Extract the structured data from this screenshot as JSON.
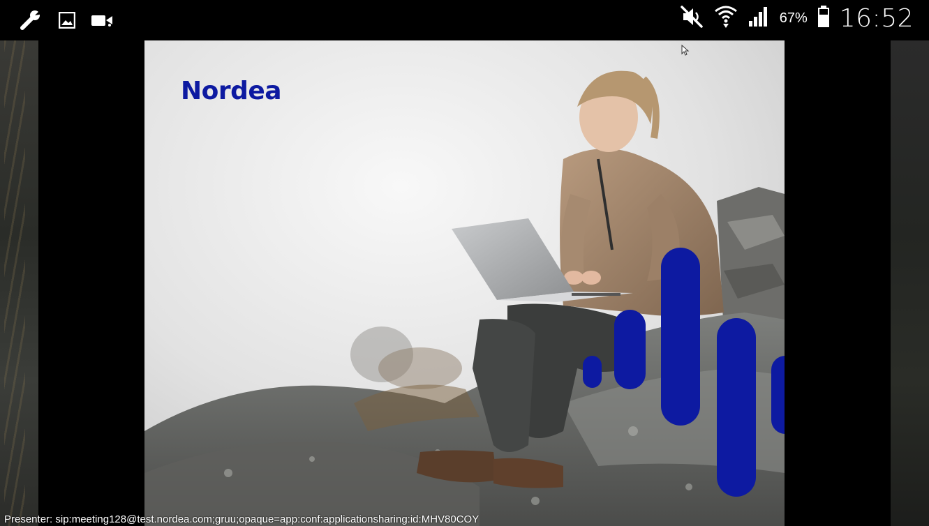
{
  "status_bar": {
    "left_icons": [
      "wrench-icon",
      "image-icon",
      "video-icon"
    ],
    "right_icons": [
      "mute-icon",
      "wifi-icon",
      "signal-icon",
      "battery-icon"
    ],
    "battery_percent": "67%",
    "time": "16:52"
  },
  "slide": {
    "brand": "Nordea",
    "brand_color": "#0d1aa1",
    "bars_color": "#0d1aa1"
  },
  "presenter": {
    "text": "Presenter: sip:meeting128@test.nordea.com;gruu;opaque=app:conf:applicationsharing:id:MHV80COY"
  }
}
